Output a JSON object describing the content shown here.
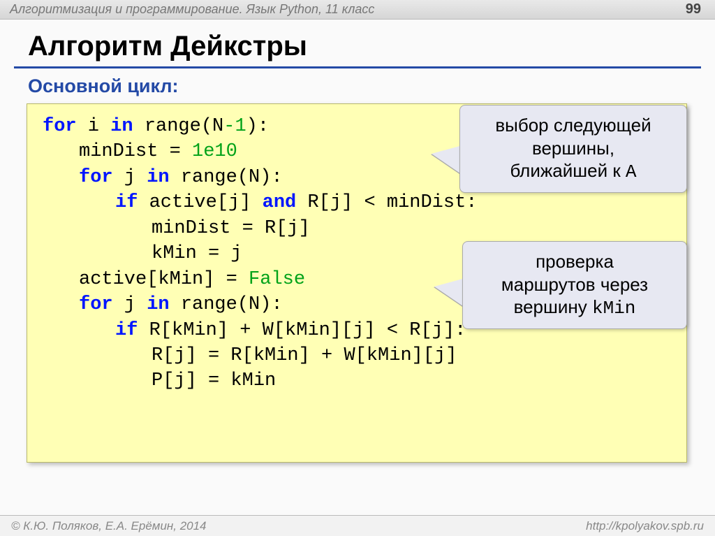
{
  "header": {
    "course": "Алгоритмизация и программирование. Язык Python, 11 класс",
    "page": "99"
  },
  "title": "Алгоритм Дейкстры",
  "subtitle": "Основной цикл:",
  "code": {
    "l1": {
      "kw1": "for",
      "t1": " i ",
      "kw2": "in",
      "t2": " range(N",
      "num": "-1",
      "t3": "):"
    },
    "l2": {
      "t1": "minDist = ",
      "num": "1e10"
    },
    "l3": {
      "kw1": "for",
      "t1": " j ",
      "kw2": "in",
      "t2": " range(N):"
    },
    "l4": {
      "kw1": "if",
      "t1": " active[j] ",
      "kw2": "and",
      "t2": " R[j] < minDist:"
    },
    "l5": "minDist = R[j]",
    "l6": "kMin = j",
    "l7": {
      "t1": "active[kMin] = ",
      "lit": "False"
    },
    "l8": {
      "kw1": "for",
      "t1": " j ",
      "kw2": "in",
      "t2": " range(N):"
    },
    "l9": {
      "kw1": "if",
      "t1": " R[kMin] + W[kMin][j] < R[j]:"
    },
    "l10": "R[j] = R[kMin] + W[kMin][j]",
    "l11": "P[j] = kMin"
  },
  "callouts": {
    "c1": {
      "line1": "выбор следующей",
      "line2": "вершины,",
      "line3_pre": "ближайшей к ",
      "line3_code": "A"
    },
    "c2": {
      "line1": "проверка",
      "line2": "маршрутов через",
      "line3_pre": "вершину ",
      "line3_code": "kMin"
    }
  },
  "footer": {
    "left": "© К.Ю. Поляков, Е.А. Ерёмин, 2014",
    "right": "http://kpolyakov.spb.ru"
  }
}
